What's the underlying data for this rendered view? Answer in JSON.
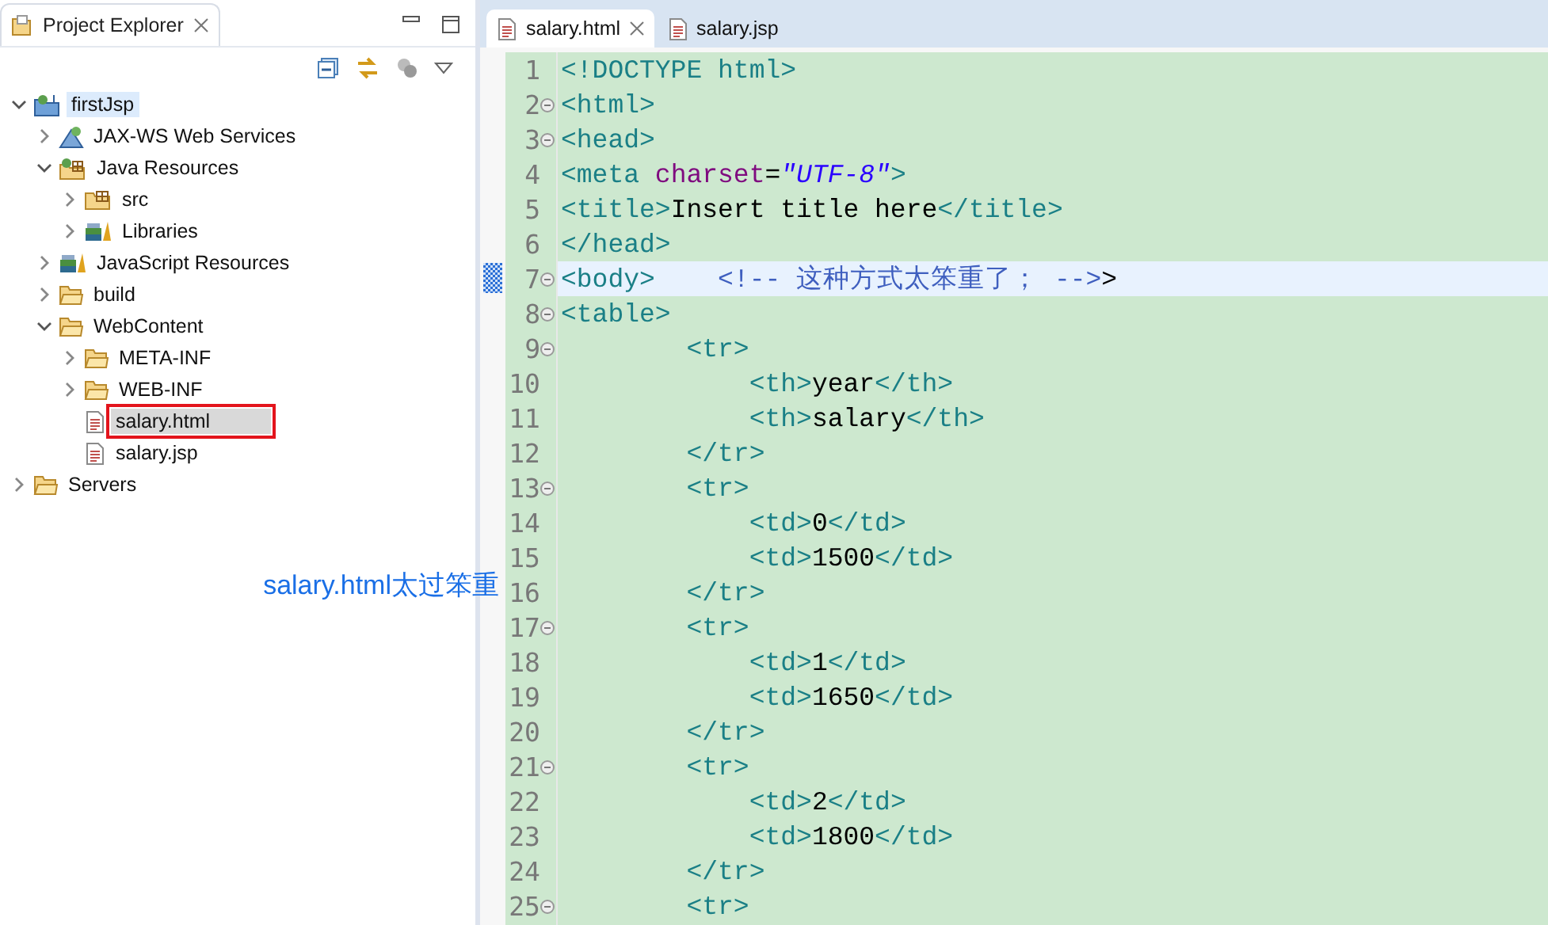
{
  "explorer": {
    "tab": {
      "label": "Project Explorer",
      "selected": true
    },
    "tree": [
      {
        "label": "firstJsp",
        "kind": "project",
        "expanded": true,
        "selected": false,
        "focused": true,
        "annotated": false,
        "children": [
          {
            "label": "JAX-WS Web Services",
            "kind": "webservice",
            "expanded": false,
            "selected": false,
            "focused": false,
            "annotated": false
          },
          {
            "label": "Java Resources",
            "kind": "javares",
            "expanded": true,
            "selected": false,
            "focused": false,
            "annotated": false,
            "children": [
              {
                "label": "src",
                "kind": "package",
                "expanded": false,
                "selected": false,
                "focused": false,
                "annotated": false
              },
              {
                "label": "Libraries",
                "kind": "library",
                "expanded": false,
                "selected": false,
                "focused": false,
                "annotated": false
              }
            ]
          },
          {
            "label": "JavaScript Resources",
            "kind": "library",
            "expanded": false,
            "selected": false,
            "focused": false,
            "annotated": false
          },
          {
            "label": "build",
            "kind": "folder",
            "expanded": false,
            "selected": false,
            "focused": false,
            "annotated": false
          },
          {
            "label": "WebContent",
            "kind": "folder",
            "expanded": true,
            "selected": false,
            "focused": false,
            "annotated": false,
            "children": [
              {
                "label": "META-INF",
                "kind": "folder",
                "expanded": false,
                "selected": false,
                "focused": false,
                "annotated": false
              },
              {
                "label": "WEB-INF",
                "kind": "folder",
                "expanded": false,
                "selected": false,
                "focused": false,
                "annotated": false
              },
              {
                "label": "salary.html",
                "kind": "file",
                "selected": true,
                "focused": false,
                "annotated": true
              },
              {
                "label": "salary.jsp",
                "kind": "file",
                "selected": false,
                "focused": false,
                "annotated": false
              }
            ]
          }
        ]
      },
      {
        "label": "Servers",
        "kind": "folder",
        "expanded": false,
        "selected": false,
        "focused": false,
        "annotated": false
      }
    ]
  },
  "annotation": "salary.html太过笨重",
  "editor": {
    "tabs": [
      {
        "label": "salary.html",
        "selected": true
      },
      {
        "label": "salary.jsp",
        "selected": false
      }
    ],
    "lines": [
      {
        "number": "1",
        "fold": false,
        "current": false,
        "tokens": [
          {
            "kind": "tag",
            "text": "<!DOCTYPE html>"
          }
        ]
      },
      {
        "number": "2",
        "fold": true,
        "current": false,
        "tokens": [
          {
            "kind": "tag",
            "text": "<html>"
          }
        ]
      },
      {
        "number": "3",
        "fold": true,
        "current": false,
        "tokens": [
          {
            "kind": "tag",
            "text": "<head>"
          }
        ]
      },
      {
        "number": "4",
        "fold": false,
        "current": false,
        "tokens": [
          {
            "kind": "tag",
            "text": "<meta "
          },
          {
            "kind": "attr",
            "text": "charset"
          },
          {
            "kind": "text",
            "text": "="
          },
          {
            "kind": "string",
            "text": "\"UTF-8\""
          },
          {
            "kind": "tag",
            "text": ">"
          }
        ]
      },
      {
        "number": "5",
        "fold": false,
        "current": false,
        "tokens": [
          {
            "kind": "tag",
            "text": "<title>"
          },
          {
            "kind": "text",
            "text": "Insert title here"
          },
          {
            "kind": "tag",
            "text": "</title>"
          }
        ]
      },
      {
        "number": "6",
        "fold": false,
        "current": false,
        "tokens": [
          {
            "kind": "tag",
            "text": "</head>"
          }
        ]
      },
      {
        "number": "7",
        "fold": true,
        "current": true,
        "tokens": [
          {
            "kind": "tag",
            "text": "<body>"
          },
          {
            "kind": "comment",
            "text": "    <!-- 这种方式太笨重了； -->"
          },
          {
            "kind": "text",
            "text": ">"
          }
        ]
      },
      {
        "number": "8",
        "fold": true,
        "current": false,
        "tokens": [
          {
            "kind": "tag",
            "text": "<table>"
          }
        ]
      },
      {
        "number": "9",
        "fold": true,
        "current": false,
        "tokens": [
          {
            "kind": "tag",
            "text": "        <tr>"
          }
        ]
      },
      {
        "number": "10",
        "fold": false,
        "current": false,
        "tokens": [
          {
            "kind": "tag",
            "text": "            <th>"
          },
          {
            "kind": "text",
            "text": "year"
          },
          {
            "kind": "tag",
            "text": "</th>"
          }
        ]
      },
      {
        "number": "11",
        "fold": false,
        "current": false,
        "tokens": [
          {
            "kind": "tag",
            "text": "            <th>"
          },
          {
            "kind": "text",
            "text": "salary"
          },
          {
            "kind": "tag",
            "text": "</th>"
          }
        ]
      },
      {
        "number": "12",
        "fold": false,
        "current": false,
        "tokens": [
          {
            "kind": "tag",
            "text": "        </tr>"
          }
        ]
      },
      {
        "number": "13",
        "fold": true,
        "current": false,
        "tokens": [
          {
            "kind": "tag",
            "text": "        <tr>"
          }
        ]
      },
      {
        "number": "14",
        "fold": false,
        "current": false,
        "tokens": [
          {
            "kind": "tag",
            "text": "            <td>"
          },
          {
            "kind": "text",
            "text": "0"
          },
          {
            "kind": "tag",
            "text": "</td>"
          }
        ]
      },
      {
        "number": "15",
        "fold": false,
        "current": false,
        "tokens": [
          {
            "kind": "tag",
            "text": "            <td>"
          },
          {
            "kind": "text",
            "text": "1500"
          },
          {
            "kind": "tag",
            "text": "</td>"
          }
        ]
      },
      {
        "number": "16",
        "fold": false,
        "current": false,
        "tokens": [
          {
            "kind": "tag",
            "text": "        </tr>"
          }
        ]
      },
      {
        "number": "17",
        "fold": true,
        "current": false,
        "tokens": [
          {
            "kind": "tag",
            "text": "        <tr>"
          }
        ]
      },
      {
        "number": "18",
        "fold": false,
        "current": false,
        "tokens": [
          {
            "kind": "tag",
            "text": "            <td>"
          },
          {
            "kind": "text",
            "text": "1"
          },
          {
            "kind": "tag",
            "text": "</td>"
          }
        ]
      },
      {
        "number": "19",
        "fold": false,
        "current": false,
        "tokens": [
          {
            "kind": "tag",
            "text": "            <td>"
          },
          {
            "kind": "text",
            "text": "1650"
          },
          {
            "kind": "tag",
            "text": "</td>"
          }
        ]
      },
      {
        "number": "20",
        "fold": false,
        "current": false,
        "tokens": [
          {
            "kind": "tag",
            "text": "        </tr>"
          }
        ]
      },
      {
        "number": "21",
        "fold": true,
        "current": false,
        "tokens": [
          {
            "kind": "tag",
            "text": "        <tr>"
          }
        ]
      },
      {
        "number": "22",
        "fold": false,
        "current": false,
        "tokens": [
          {
            "kind": "tag",
            "text": "            <td>"
          },
          {
            "kind": "text",
            "text": "2"
          },
          {
            "kind": "tag",
            "text": "</td>"
          }
        ]
      },
      {
        "number": "23",
        "fold": false,
        "current": false,
        "tokens": [
          {
            "kind": "tag",
            "text": "            <td>"
          },
          {
            "kind": "text",
            "text": "1800"
          },
          {
            "kind": "tag",
            "text": "</td>"
          }
        ]
      },
      {
        "number": "24",
        "fold": false,
        "current": false,
        "tokens": [
          {
            "kind": "tag",
            "text": "        </tr>"
          }
        ]
      },
      {
        "number": "25",
        "fold": true,
        "current": false,
        "tokens": [
          {
            "kind": "tag",
            "text": "        <tr>"
          }
        ]
      }
    ]
  }
}
